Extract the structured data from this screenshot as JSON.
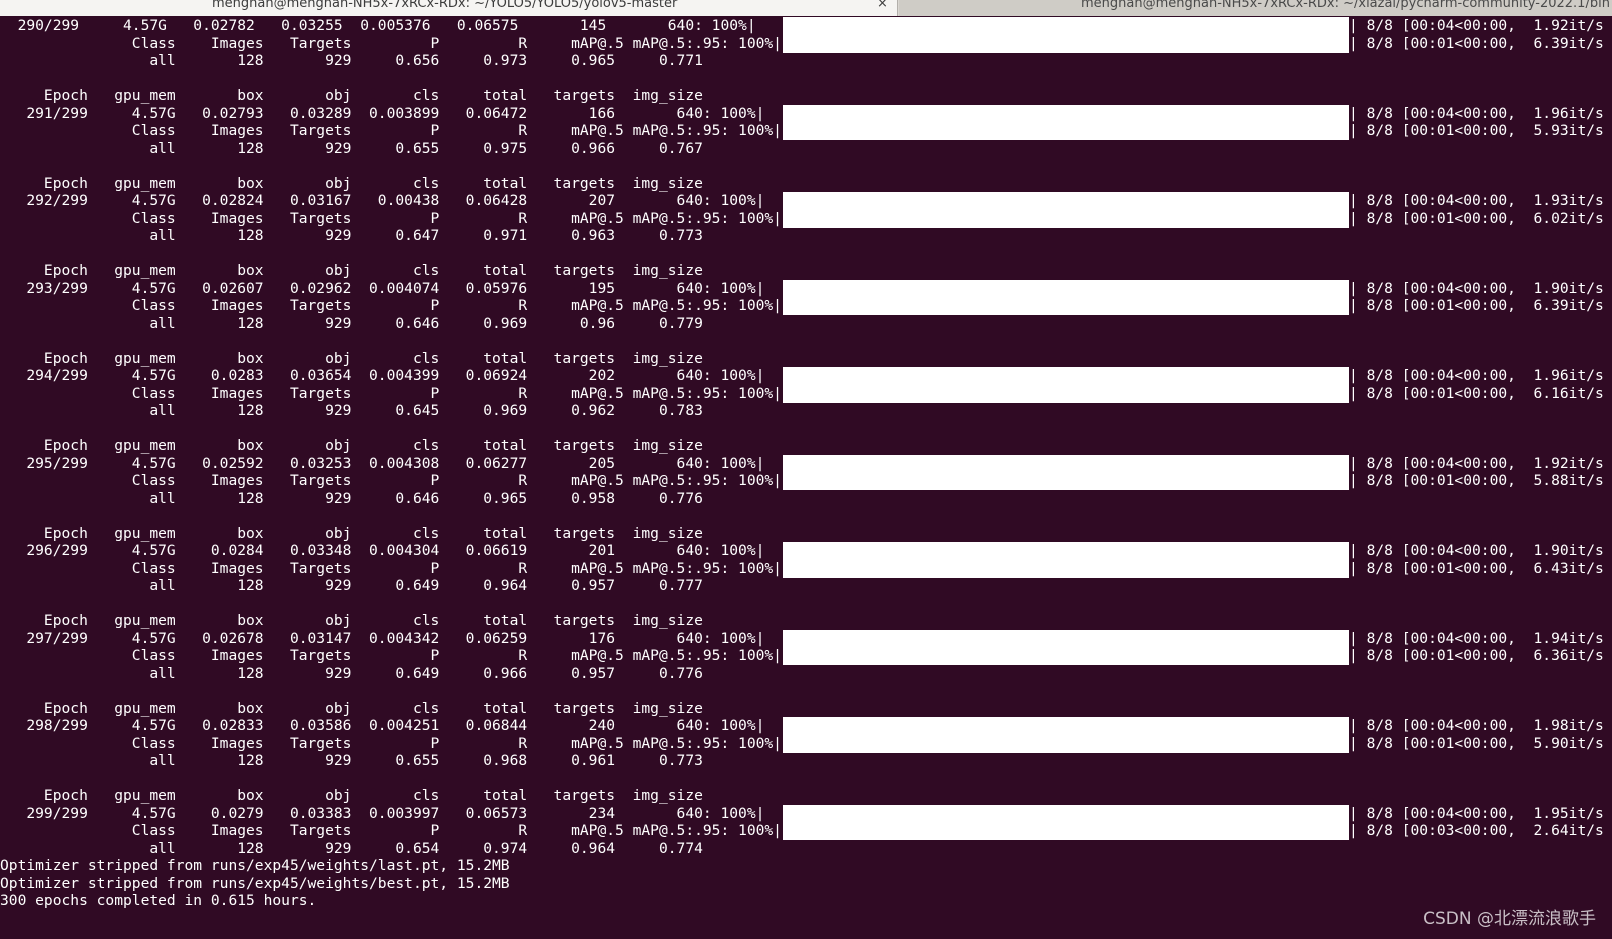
{
  "window": {
    "tabs": [
      {
        "title": "menghan@menghan-NH5x-7xRCx-RDx: ~/YOLO5/YOLO5/yolov5-master",
        "active": true
      },
      {
        "title": "menghan@menghan-NH5x-7xRCx-RDx: ~/xiazai/pycharm-community-2022.1/bin",
        "active": false
      }
    ],
    "close_glyph": "×"
  },
  "terminal": {
    "top_block": {
      "train_line": "  290/299     4.57G   0.02782   0.03255  0.005376   0.06575       145       640: 100%|",
      "train_tail": "| 8/8 [00:04<00:00,  1.92it/s",
      "val_header": "               Class    Images   Targets         P         R     mAP@.5 mAP@.5:.95: 100%|",
      "val_tail": "| 8/8 [00:01<00:00,  6.39it/s",
      "val_result": "                 all       128       929     0.656     0.973     0.965     0.771"
    },
    "epochs": [
      {
        "header": "     Epoch   gpu_mem       box       obj       cls     total   targets  img_size",
        "train_line": "   291/299     4.57G   0.02793   0.03289  0.003899   0.06472       166       640: 100%|",
        "train_tail": "| 8/8 [00:04<00:00,  1.96it/s",
        "val_header": "               Class    Images   Targets         P         R     mAP@.5 mAP@.5:.95: 100%|",
        "val_tail": "| 8/8 [00:01<00:00,  5.93it/s",
        "val_result": "                 all       128       929     0.655     0.975     0.966     0.767"
      },
      {
        "header": "     Epoch   gpu_mem       box       obj       cls     total   targets  img_size",
        "train_line": "   292/299     4.57G   0.02824   0.03167   0.00438   0.06428       207       640: 100%|",
        "train_tail": "| 8/8 [00:04<00:00,  1.93it/s",
        "val_header": "               Class    Images   Targets         P         R     mAP@.5 mAP@.5:.95: 100%|",
        "val_tail": "| 8/8 [00:01<00:00,  6.02it/s",
        "val_result": "                 all       128       929     0.647     0.971     0.963     0.773"
      },
      {
        "header": "     Epoch   gpu_mem       box       obj       cls     total   targets  img_size",
        "train_line": "   293/299     4.57G   0.02607   0.02962  0.004074   0.05976       195       640: 100%|",
        "train_tail": "| 8/8 [00:04<00:00,  1.90it/s",
        "val_header": "               Class    Images   Targets         P         R     mAP@.5 mAP@.5:.95: 100%|",
        "val_tail": "| 8/8 [00:01<00:00,  6.39it/s",
        "val_result": "                 all       128       929     0.646     0.969      0.96     0.779"
      },
      {
        "header": "     Epoch   gpu_mem       box       obj       cls     total   targets  img_size",
        "train_line": "   294/299     4.57G    0.0283   0.03654  0.004399   0.06924       202       640: 100%|",
        "train_tail": "| 8/8 [00:04<00:00,  1.96it/s",
        "val_header": "               Class    Images   Targets         P         R     mAP@.5 mAP@.5:.95: 100%|",
        "val_tail": "| 8/8 [00:01<00:00,  6.16it/s",
        "val_result": "                 all       128       929     0.645     0.969     0.962     0.783"
      },
      {
        "header": "     Epoch   gpu_mem       box       obj       cls     total   targets  img_size",
        "train_line": "   295/299     4.57G   0.02592   0.03253  0.004308   0.06277       205       640: 100%|",
        "train_tail": "| 8/8 [00:04<00:00,  1.92it/s",
        "val_header": "               Class    Images   Targets         P         R     mAP@.5 mAP@.5:.95: 100%|",
        "val_tail": "| 8/8 [00:01<00:00,  5.88it/s",
        "val_result": "                 all       128       929     0.646     0.965     0.958     0.776"
      },
      {
        "header": "     Epoch   gpu_mem       box       obj       cls     total   targets  img_size",
        "train_line": "   296/299     4.57G    0.0284   0.03348  0.004304   0.06619       201       640: 100%|",
        "train_tail": "| 8/8 [00:04<00:00,  1.90it/s",
        "val_header": "               Class    Images   Targets         P         R     mAP@.5 mAP@.5:.95: 100%|",
        "val_tail": "| 8/8 [00:01<00:00,  6.43it/s",
        "val_result": "                 all       128       929     0.649     0.964     0.957     0.777"
      },
      {
        "header": "     Epoch   gpu_mem       box       obj       cls     total   targets  img_size",
        "train_line": "   297/299     4.57G   0.02678   0.03147  0.004342   0.06259       176       640: 100%|",
        "train_tail": "| 8/8 [00:04<00:00,  1.94it/s",
        "val_header": "               Class    Images   Targets         P         R     mAP@.5 mAP@.5:.95: 100%|",
        "val_tail": "| 8/8 [00:01<00:00,  6.36it/s",
        "val_result": "                 all       128       929     0.649     0.966     0.957     0.776"
      },
      {
        "header": "     Epoch   gpu_mem       box       obj       cls     total   targets  img_size",
        "train_line": "   298/299     4.57G   0.02833   0.03586  0.004251   0.06844       240       640: 100%|",
        "train_tail": "| 8/8 [00:04<00:00,  1.98it/s",
        "val_header": "               Class    Images   Targets         P         R     mAP@.5 mAP@.5:.95: 100%|",
        "val_tail": "| 8/8 [00:01<00:00,  5.90it/s",
        "val_result": "                 all       128       929     0.655     0.968     0.961     0.773"
      },
      {
        "header": "     Epoch   gpu_mem       box       obj       cls     total   targets  img_size",
        "train_line": "   299/299     4.57G    0.0279   0.03383  0.003997   0.06573       234       640: 100%|",
        "train_tail": "| 8/8 [00:04<00:00,  1.95it/s",
        "val_header": "               Class    Images   Targets         P         R     mAP@.5 mAP@.5:.95: 100%|",
        "val_tail": "| 8/8 [00:03<00:00,  2.64it/s",
        "val_result": "                 all       128       929     0.654     0.974     0.964     0.774"
      }
    ],
    "final_lines": [
      "Optimizer stripped from runs/exp45/weights/last.pt, 15.2MB",
      "Optimizer stripped from runs/exp45/weights/best.pt, 15.2MB",
      "300 epochs completed in 0.615 hours."
    ]
  },
  "watermark": "CSDN @北漂流浪歌手",
  "colors": {
    "terminal_bg": "#300a24",
    "terminal_fg": "#ffffff",
    "progress_fill": "#ffffff",
    "tabbar_bg": "#dad7d2"
  },
  "progress_fraction": 1.0
}
